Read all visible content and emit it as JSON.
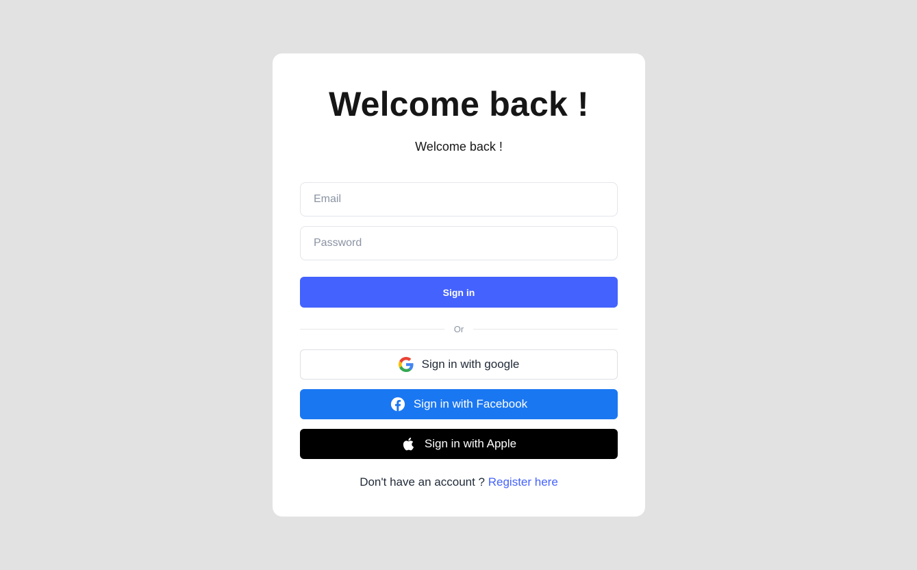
{
  "card": {
    "title": "Welcome back !",
    "subtitle": "Welcome back !"
  },
  "form": {
    "email": {
      "value": "",
      "placeholder": "Email"
    },
    "password": {
      "value": "",
      "placeholder": "Password"
    },
    "sign_in_label": "Sign in"
  },
  "divider": {
    "label": "Or"
  },
  "social": {
    "google": {
      "label": "Sign in with google",
      "icon": "google-icon"
    },
    "facebook": {
      "label": "Sign in with Facebook",
      "icon": "facebook-icon"
    },
    "apple": {
      "label": "Sign in with Apple",
      "icon": "apple-icon"
    }
  },
  "footer": {
    "prompt": "Don't have an account ?",
    "link_label": "Register here"
  },
  "colors": {
    "background": "#e2e2e2",
    "card": "#ffffff",
    "primary": "#4462fd",
    "facebook": "#1a77f2",
    "apple": "#000000",
    "text": "#161616",
    "placeholder": "#8a93a3"
  }
}
